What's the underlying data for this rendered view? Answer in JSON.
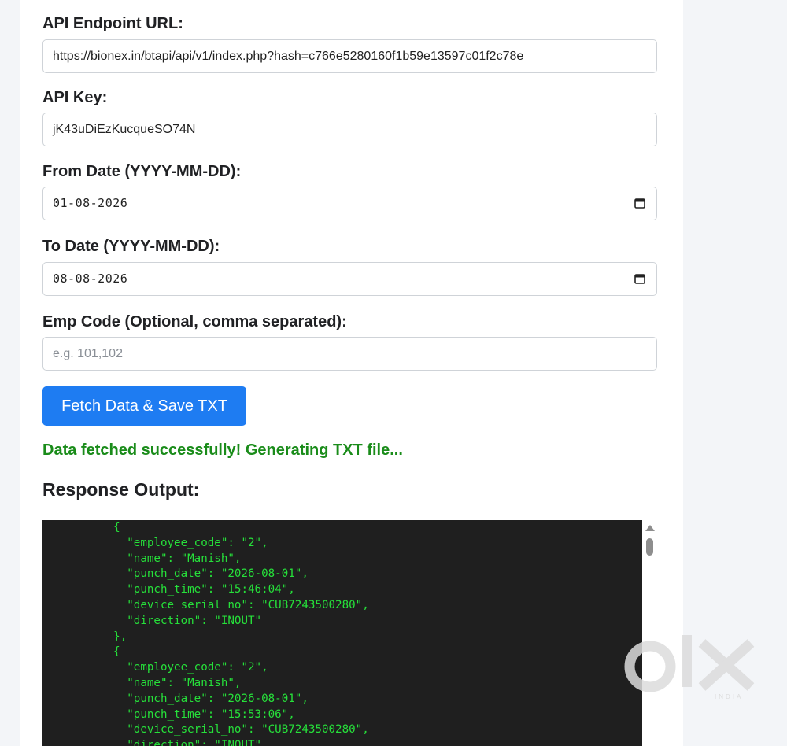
{
  "form": {
    "api_url_label": "API Endpoint URL:",
    "api_url_value": "https://bionex.in/btapi/api/v1/index.php?hash=c766e5280160f1b59e13597c01f2c78e",
    "api_key_label": "API Key:",
    "api_key_value": "jK43uDiEzKucqueSO74N",
    "from_date_label": "From Date (YYYY-MM-DD):",
    "from_date_value": "01-08-2026",
    "to_date_label": "To Date (YYYY-MM-DD):",
    "to_date_value": "08-08-2026",
    "emp_code_label": "Emp Code (Optional, comma separated):",
    "emp_code_placeholder": "e.g. 101,102",
    "emp_code_value": ""
  },
  "actions": {
    "fetch_button_label": "Fetch Data & Save TXT"
  },
  "status": {
    "message": "Data fetched successfully! Generating TXT file...",
    "color": "#1a8c1a"
  },
  "response": {
    "title": "Response Output:",
    "output_text": "    {\n      \"employee_code\": \"2\",\n      \"name\": \"Manish\",\n      \"punch_date\": \"2026-08-01\",\n      \"punch_time\": \"15:46:04\",\n      \"device_serial_no\": \"CUB7243500280\",\n      \"direction\": \"INOUT\"\n    },\n    {\n      \"employee_code\": \"2\",\n      \"name\": \"Manish\",\n      \"punch_date\": \"2026-08-01\",\n      \"punch_time\": \"15:53:06\",\n      \"device_serial_no\": \"CUB7243500280\",\n      \"direction\": \"INOUT\""
  },
  "watermark": {
    "brand": "OLX",
    "sub": "INDIA"
  },
  "colors": {
    "accent": "#1e7cf2",
    "console_bg": "#1f1f1f",
    "console_text": "#26e03a"
  },
  "icons": [
    "calendar-icon",
    "scroll-up-arrow-icon",
    "olx-logo"
  ]
}
